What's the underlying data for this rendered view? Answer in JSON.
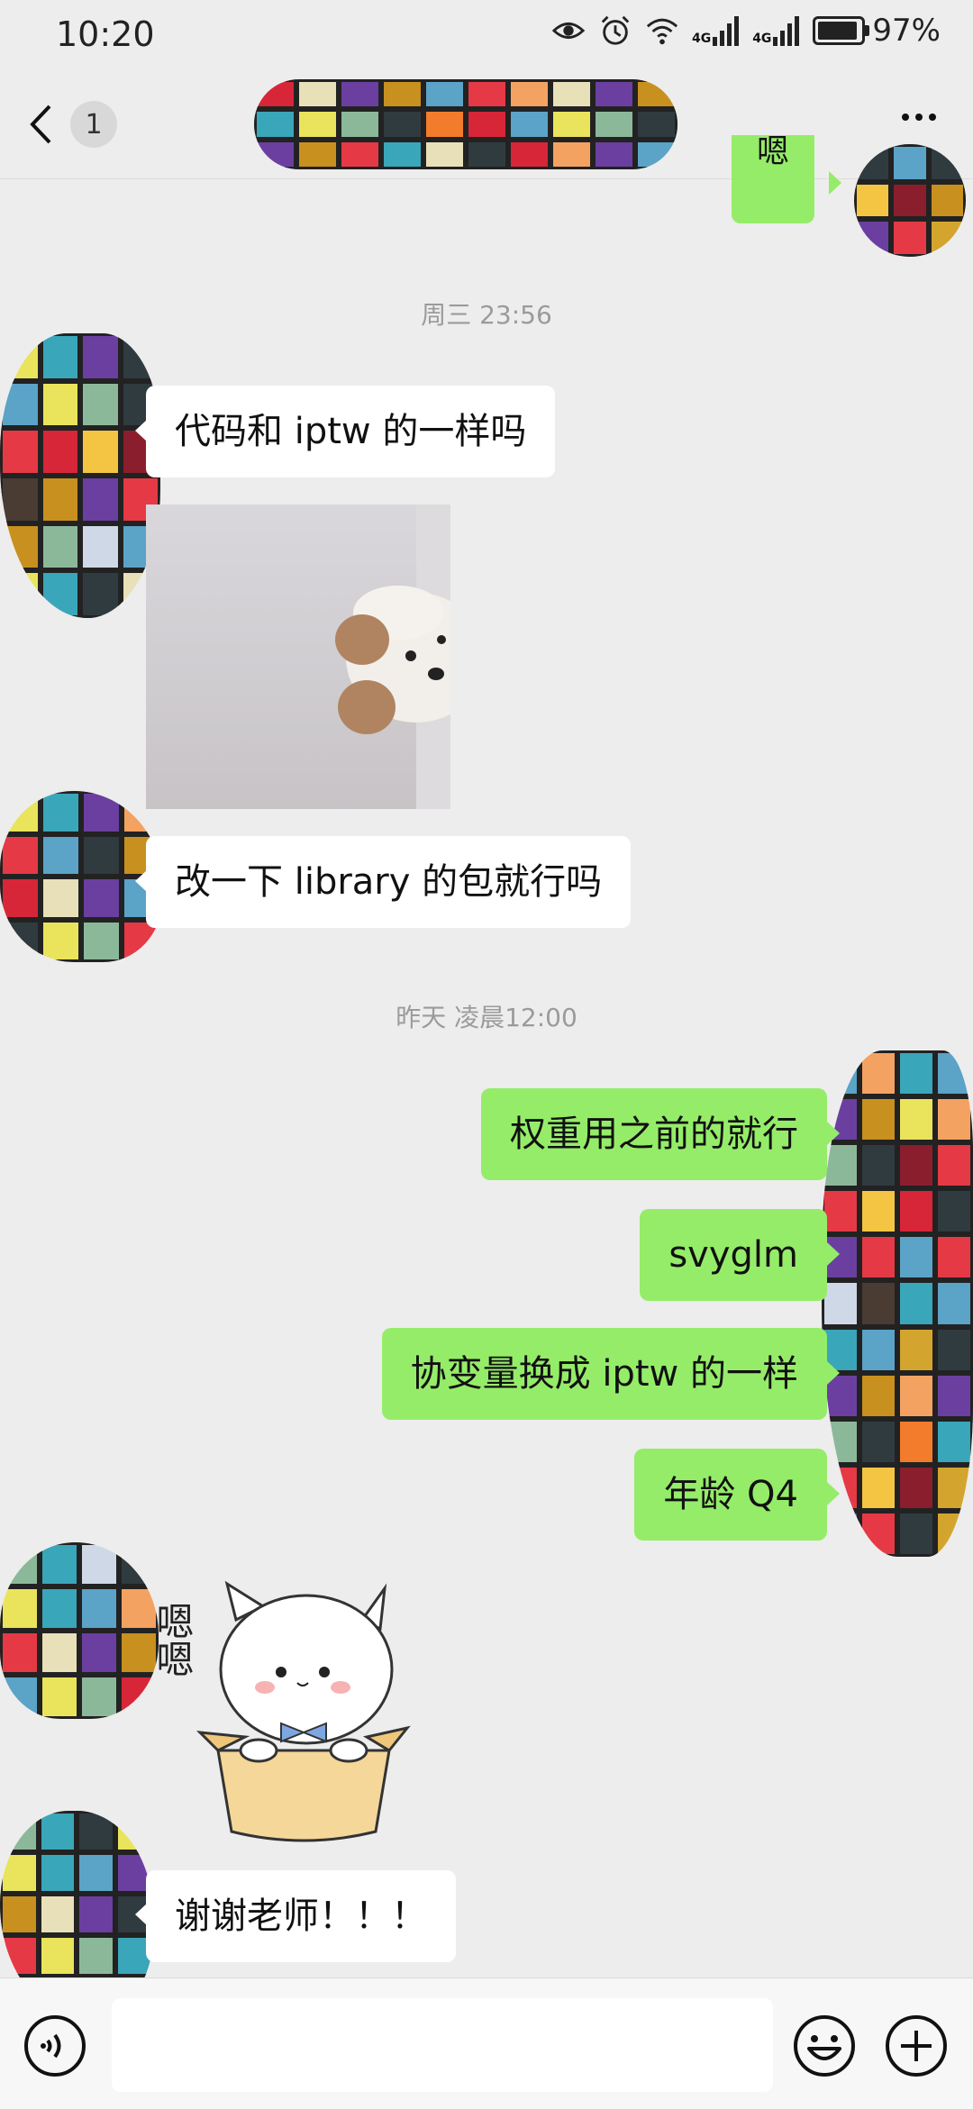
{
  "status": {
    "time": "10:20",
    "signal1": "4G",
    "signal2": "4G",
    "battery": "97%"
  },
  "header": {
    "unread_count": "1"
  },
  "messages": [
    {
      "type": "out",
      "text": "嗯"
    },
    {
      "type": "time",
      "text": "周三 23:56"
    },
    {
      "type": "in",
      "text": "代码和 iptw 的一样吗"
    },
    {
      "type": "in-image",
      "icon": "puppy-peeking-image"
    },
    {
      "type": "in",
      "text": "改一下 library 的包就行吗"
    },
    {
      "type": "time",
      "text": "昨天 凌晨12:00"
    },
    {
      "type": "out",
      "text": "权重用之前的就行"
    },
    {
      "type": "out",
      "text": "svyglm"
    },
    {
      "type": "out",
      "text": "协变量换成 iptw 的一样"
    },
    {
      "type": "out",
      "text": "年龄 Q4"
    },
    {
      "type": "in-sticker",
      "text": "嗯嗯"
    },
    {
      "type": "in",
      "text": "谢谢老师！！！"
    }
  ],
  "input": {
    "placeholder": ""
  },
  "colors": {
    "background": "#EDEDED",
    "outgoing_bubble": "#95EC69",
    "incoming_bubble": "#FFFFFF",
    "timestamp": "#9B9B9B"
  },
  "icons": [
    "back-chevron-icon",
    "more-dots-icon",
    "eye-icon",
    "alarm-icon",
    "wifi-icon",
    "signal-icon",
    "battery-icon",
    "voice-icon",
    "emoji-icon",
    "plus-icon"
  ]
}
